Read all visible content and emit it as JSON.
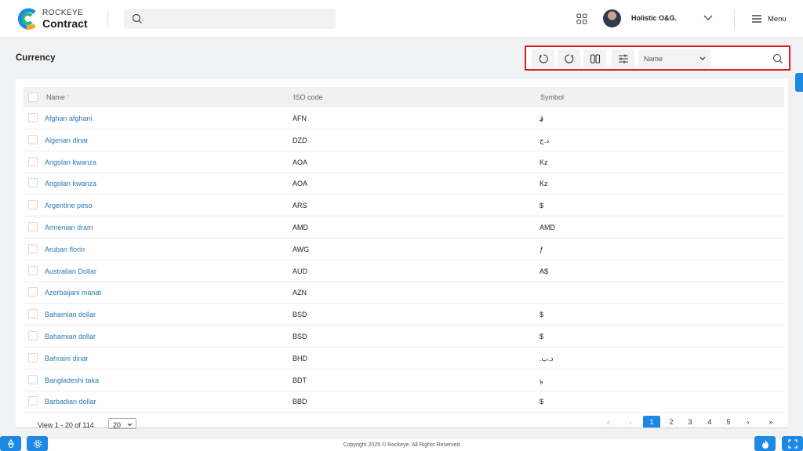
{
  "header": {
    "brand_top": "ROCKEYE",
    "brand_main": "Contract",
    "user_name": "Holistic O&G.",
    "menu_label": "Menu"
  },
  "page": {
    "title": "Currency"
  },
  "toolbar": {
    "filter_field": "Name"
  },
  "table": {
    "headers": {
      "name": "Name",
      "sort_indicator": "↑",
      "iso": "ISO code",
      "symbol": "Symbol"
    },
    "rows": [
      {
        "name": "Afghan afghani",
        "iso": "AFN",
        "symbol": "؋"
      },
      {
        "name": "Algerian dinar",
        "iso": "DZD",
        "symbol": "د.ج"
      },
      {
        "name": "Angolan kwanza",
        "iso": "AOA",
        "symbol": "Kz"
      },
      {
        "name": "Angolan kwanza",
        "iso": "AOA",
        "symbol": "Kz"
      },
      {
        "name": "Argentine peso",
        "iso": "ARS",
        "symbol": "$"
      },
      {
        "name": "Armenian dram",
        "iso": "AMD",
        "symbol": "AMD"
      },
      {
        "name": "Aruban florin",
        "iso": "AWG",
        "symbol": "ƒ"
      },
      {
        "name": "Australian Dollar",
        "iso": "AUD",
        "symbol": "A$"
      },
      {
        "name": "Azerbaijani manat",
        "iso": "AZN",
        "symbol": ""
      },
      {
        "name": "Bahamian dollar",
        "iso": "BSD",
        "symbol": "$"
      },
      {
        "name": "Bahamian dollar",
        "iso": "BSD",
        "symbol": "$"
      },
      {
        "name": "Bahraini dinar",
        "iso": "BHD",
        "symbol": ".د.ب"
      },
      {
        "name": "Bangladeshi taka",
        "iso": "BDT",
        "symbol": "৳"
      },
      {
        "name": "Barbadian dollar",
        "iso": "BBD",
        "symbol": "$"
      }
    ]
  },
  "pagination": {
    "view_label": "View 1 - 20 of 114",
    "page_size": "20",
    "first": "«",
    "prev": "‹",
    "pages": [
      "1",
      "2",
      "3",
      "4",
      "5"
    ],
    "active_page": "1",
    "next": "›",
    "last": "»"
  },
  "footer": {
    "copyright": "Copyright 2025 © Rockeye. All Rights Reserved"
  },
  "colors": {
    "accent": "#1e88e5",
    "highlight_border": "#e0191e",
    "link": "#2a7ab7"
  }
}
